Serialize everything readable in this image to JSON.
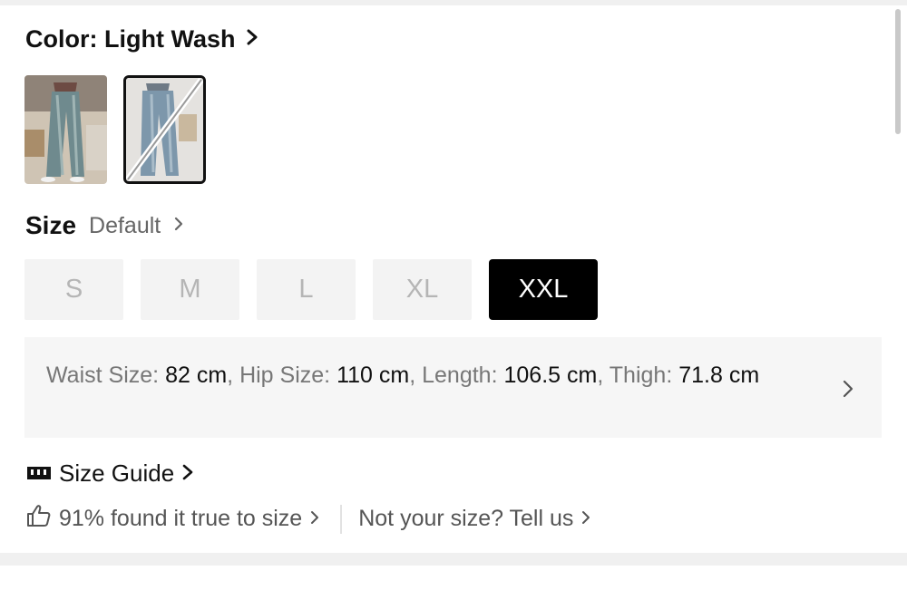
{
  "color": {
    "label": "Color: Light Wash",
    "selected_index": 1
  },
  "swatches": [
    {
      "name": "light-wash-model"
    },
    {
      "name": "light-wash-selected"
    }
  ],
  "size": {
    "title": "Size",
    "default_label": "Default"
  },
  "sizes": [
    {
      "label": "S",
      "selected": false
    },
    {
      "label": "M",
      "selected": false
    },
    {
      "label": "L",
      "selected": false
    },
    {
      "label": "XL",
      "selected": false
    },
    {
      "label": "XXL",
      "selected": true
    }
  ],
  "measurements": {
    "waist_label": "Waist Size:",
    "waist_value": "82 cm",
    "hip_label": "Hip Size:",
    "hip_value": "110 cm",
    "length_label": "Length:",
    "length_value": "106.5 cm",
    "thigh_label": "Thigh:",
    "thigh_value": "71.8 cm"
  },
  "size_guide": {
    "label": "Size Guide",
    "icon": "ruler-icon"
  },
  "fit": {
    "true_to_size": "91% found it true to size",
    "not_your_size": "Not your size? Tell us",
    "icon": "thumbs-up-icon"
  },
  "colors": {
    "accent": "#000000",
    "muted_bg": "#f3f3f3",
    "disabled_text": "#b5b5b5"
  }
}
